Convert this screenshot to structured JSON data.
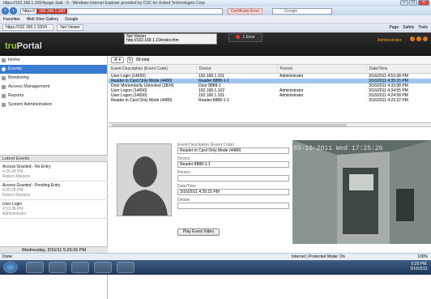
{
  "browser": {
    "title": "https://192.168.1.100/#page-1tab - 0 - Windows Internet Explorer provided by CSC for United Technologies Corp",
    "address": "https://",
    "address_highlight": "192.168.1.100",
    "cert_error": "Certificate Error",
    "search_placeholder": "Google",
    "favorites": [
      "Favorites",
      "Web Slice Gallery",
      "Google"
    ],
    "tab_url": "https://192.168.1.100/#...",
    "tab_title": "Net Viewer",
    "commands": [
      "Page",
      "Safety",
      "Tools"
    ]
  },
  "app": {
    "logo_prefix": "tru",
    "logo_suffix": "Portal",
    "notif_title": "Net Viewer",
    "notif_url": "http://192.168.1.10/index.htm",
    "error_label": "1 Error",
    "admin_label": "Administrator"
  },
  "sidebar": {
    "items": [
      {
        "label": "Home"
      },
      {
        "label": "Events"
      },
      {
        "label": "Monitoring"
      },
      {
        "label": "Access Management"
      },
      {
        "label": "Reports"
      },
      {
        "label": "System Administration"
      }
    ],
    "latest_title": "Latest Events",
    "latest": [
      {
        "title": "Access Granted - No Entry",
        "time": "4:35:28 PM",
        "who": "Robert Masters"
      },
      {
        "title": "Access Granted - Pending Entry",
        "time": "4:35:28 PM",
        "who": "Robert Masters"
      },
      {
        "title": "User Login",
        "time": "4:53:38 PM",
        "who": "Administrator"
      }
    ],
    "date": "Wednesday, 3/16/11 5:25:26 PM"
  },
  "events": {
    "total": "69 total",
    "columns": [
      "Event Description (Event Code)",
      "Device",
      "Person",
      "Date/Time"
    ],
    "rows": [
      [
        "User Login (14650)",
        "192.168.1.101",
        "Administrator",
        "3/16/2011 4:53:38 PM"
      ],
      [
        "Reader in Card Only Mode (4480)",
        "Reader 8888-1-1",
        "",
        "3/16/2011 4:35:15 PM"
      ],
      [
        "Door Momentarily Unlocked (3824)",
        "Door 8888-1",
        "",
        "3/16/2011 4:33:08 PM"
      ],
      [
        "User Logon (14650)",
        "192.168.1.102",
        "Administrator",
        "3/16/2011 4:34:55 PM"
      ],
      [
        "User Logon (14650)",
        "192.168.1.101",
        "Administrator",
        "3/16/2011 4:24:58 PM"
      ],
      [
        "Reader in Card Only Mode (4480)",
        "Reader 8888-1-1",
        "",
        "3/16/2011 4:23:22 PM"
      ]
    ],
    "selected_row": 1
  },
  "detail": {
    "event_label": "Event Description (Event Code)",
    "event_value": "Reader in Card Only Mode (4480)",
    "device_label": "Device",
    "device_value": "Reader 8888-1-1",
    "person_label": "Person",
    "person_value": "",
    "datetime_label": "Date/Time",
    "datetime_value": "3/16/2011 4:35:15 PM",
    "details_label": "Details",
    "details_value": "",
    "play_label": "Play Event Video",
    "video_timestamp": "03-16-2011 Wed 17:25:26"
  },
  "status": {
    "left": "Done",
    "zone": "Internet | Protected Mode: On",
    "zoom": "100%"
  },
  "clock": {
    "time": "5:25 PM",
    "date": "3/16/2011"
  }
}
